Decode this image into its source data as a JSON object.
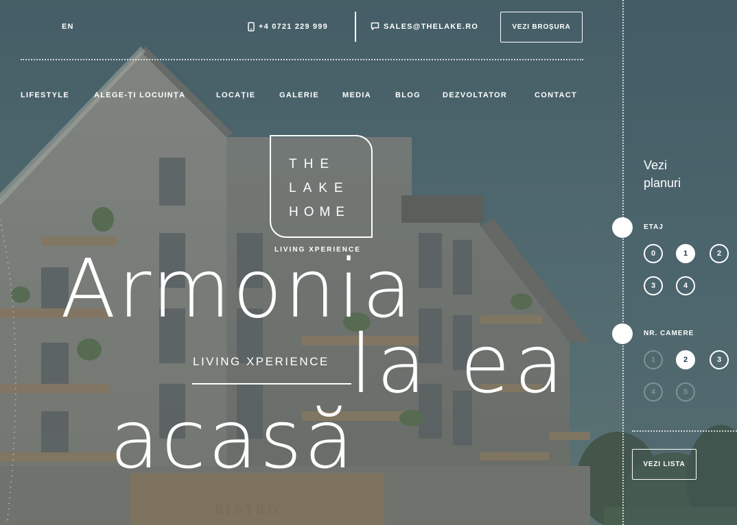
{
  "topbar": {
    "lang": "EN",
    "phone": "+4 0721 229 999",
    "email": "SALES@THELAKE.RO",
    "brochure_button": "VEZI BROȘURA"
  },
  "nav": {
    "items": [
      "LIFESTYLE",
      "ALEGE-ȚI LOCUINȚA",
      "LOCAȚIE",
      "GALERIE",
      "MEDIA",
      "BLOG",
      "DEZVOLTATOR",
      "CONTACT"
    ]
  },
  "logo": {
    "line1": "THE",
    "line2": "LAKE",
    "line3": "HOME",
    "tagline": "LIVING XPERIENCE"
  },
  "hero": {
    "line1": "Armonia",
    "line2": "la ea",
    "line3": "acasă",
    "subtitle": "LIVING XPERIENCE",
    "building_sign": "BISTRO"
  },
  "sidebar": {
    "title_line1": "Vezi",
    "title_line2": "planuri",
    "floor_label": "ETAJ",
    "floors": [
      "0",
      "1",
      "2",
      "3",
      "4"
    ],
    "floor_selected": "1",
    "rooms_label": "NR. CAMERE",
    "rooms": [
      "1",
      "2",
      "3",
      "4",
      "5"
    ],
    "rooms_selected": "2",
    "rooms_disabled": [
      "1",
      "4",
      "5"
    ],
    "list_button": "VEZI LISTA"
  },
  "colors": {
    "sky": "#56707a",
    "facade": "#c9c1b1",
    "wood": "#9d8260",
    "active_circle_text": "#253447"
  }
}
